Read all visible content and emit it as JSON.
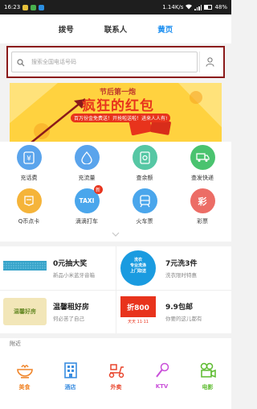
{
  "statusbar": {
    "time": "16:23",
    "speed": "1.14K/s",
    "battery": "48%"
  },
  "topnav": {
    "tabs": [
      {
        "label": "拨号"
      },
      {
        "label": "联系人"
      },
      {
        "label": "黄页"
      }
    ]
  },
  "search": {
    "placeholder": "搜索全国电话号码"
  },
  "banner": {
    "title_small": "节后第一炮",
    "title_big": "疯狂的红包",
    "subtitle": "百万份金免费送！开抢啦送啦！进来人人有!"
  },
  "grid": {
    "items": [
      {
        "label": "充话费",
        "color": "#5aa4ec",
        "icon": "yen-card-icon"
      },
      {
        "label": "充流量",
        "color": "#5aa4ec",
        "icon": "droplet-icon"
      },
      {
        "label": "查余额",
        "color": "#56c7a4",
        "icon": "balance-icon"
      },
      {
        "label": "查发快递",
        "color": "#4ac36f",
        "icon": "truck-icon"
      },
      {
        "label": "Q币点卡",
        "color": "#f5b43a",
        "icon": "penguin-icon"
      },
      {
        "label": "滴滴打车",
        "color": "#4aa6ec",
        "icon": "taxi-icon",
        "text": "TAXI",
        "badge": "新"
      },
      {
        "label": "火车票",
        "color": "#4aa6ec",
        "icon": "train-icon"
      },
      {
        "label": "彩票",
        "color": "#ec6d66",
        "icon": "lottery-icon",
        "text": "彩"
      }
    ]
  },
  "promo": {
    "cells": [
      {
        "title": "0元抽大奖",
        "sub": "新品小米蓝牙音箱"
      },
      {
        "title": "7元洗3件",
        "sub": "洗衣限时特惠",
        "icon_text": "洗衣\n专业洗涤\n上门取送"
      },
      {
        "title": "温馨租好房",
        "sub": "何必苦了自己",
        "img_text": "温馨好房"
      },
      {
        "title": "9.9包邮",
        "sub": "你要的这儿都有",
        "img_text": "折800",
        "img_sub": "天天 11·11"
      }
    ]
  },
  "nearby": {
    "label": "附近",
    "items": [
      {
        "label": "美食",
        "color": "#f0862b",
        "icon": "bowl-icon"
      },
      {
        "label": "酒店",
        "color": "#3a8de0",
        "icon": "hotel-icon"
      },
      {
        "label": "外卖",
        "color": "#e8452c",
        "icon": "scooter-icon"
      },
      {
        "label": "KTV",
        "color": "#c94fd9",
        "icon": "microphone-icon"
      },
      {
        "label": "电影",
        "color": "#5cbb2e",
        "icon": "camera-icon"
      }
    ]
  }
}
